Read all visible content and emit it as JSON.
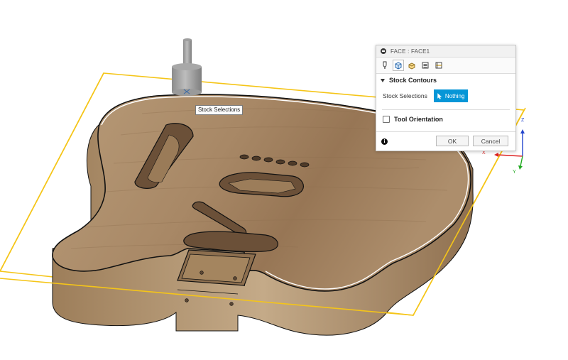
{
  "dialog": {
    "title": "FACE : FACE1",
    "tabs": [
      "tool-tab",
      "geometry-tab",
      "heights-tab",
      "passes-tab",
      "linking-tab"
    ],
    "section_stock_contours": "Stock Contours",
    "stock_selections_label": "Stock Selections",
    "nothing_button": "Nothing",
    "tool_orientation_label": "Tool Orientation",
    "tool_orientation_checked": false,
    "ok_label": "OK",
    "cancel_label": "Cancel",
    "info_glyph": "i",
    "accent_color": "#0696d7"
  },
  "tooltip": {
    "text": "Stock Selections"
  },
  "triad": {
    "z": "Z",
    "x": "X",
    "y": "Y"
  },
  "viewport": {
    "stock_outline_color": "#f5c518",
    "wood_color": "#a98a67"
  }
}
